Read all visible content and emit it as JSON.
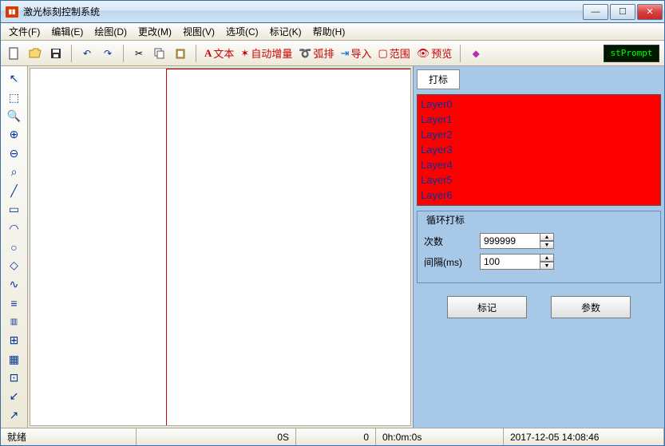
{
  "window": {
    "title": "激光标刻控制系统",
    "app_icon_text": "||||"
  },
  "menu": {
    "file": "文件(F)",
    "edit": "编辑(E)",
    "draw": "绘图(D)",
    "change": "更改(M)",
    "view": "视图(V)",
    "option": "选项(C)",
    "mark": "标记(K)",
    "help": "帮助(H)"
  },
  "toolbar": {
    "text": "文本",
    "auto_inc": "自动增量",
    "arc": "弧排",
    "import": "导入",
    "range": "范围",
    "preview": "预览",
    "status": "stPrompt"
  },
  "right": {
    "tab_mark": "打标",
    "layers": [
      "Layer0",
      "Layer1",
      "Layer2",
      "Layer3",
      "Layer4",
      "Layer5",
      "Layer6"
    ],
    "loop_title": "循环打标",
    "count_label": "次数",
    "count_value": "999999",
    "interval_label": "间隔(ms)",
    "interval_value": "100",
    "mark_btn": "标记",
    "param_btn": "参数"
  },
  "status": {
    "ready": "就绪",
    "time1": "0S",
    "count": "0",
    "time2": "0h:0m:0s",
    "datetime": "2017-12-05 14:08:46"
  }
}
